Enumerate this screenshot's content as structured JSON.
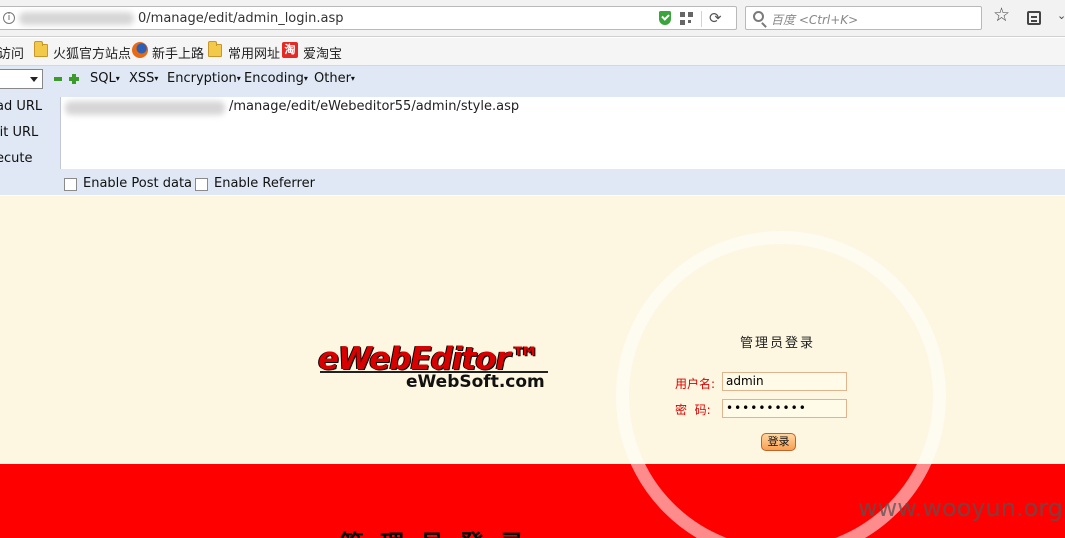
{
  "browser": {
    "url_visible": "0/manage/edit/admin_login.asp",
    "search_placeholder": "百度 <Ctrl+K>"
  },
  "bookmarks": {
    "partial_item": "访问",
    "items": [
      "火狐官方站点",
      "新手上路",
      "常用网址",
      "爱淘宝"
    ]
  },
  "hackbar": {
    "menus": [
      "SQL",
      "XSS",
      "Encryption",
      "Encoding",
      "Other"
    ],
    "actions": [
      "ad URL",
      "lit URL",
      "ecute"
    ],
    "url_field_value": "/manage/edit/eWebeditor55/admin/style.asp",
    "options": [
      "Enable Post data",
      "Enable Referrer"
    ]
  },
  "page": {
    "logo_main": "eWebEditor™",
    "logo_sub": "eWebSoft.com",
    "login_title": "管理员登录",
    "username_label": "用户名:",
    "password_label": "密  码:",
    "username_value": "admin",
    "password_value": "••••••••••",
    "login_button": "登录",
    "bottom_title": "管理员登录",
    "watermark": "www.wooyun.org"
  },
  "colors": {
    "page_bg": "#fdf6e0",
    "band": "#ff0000",
    "label_red": "#dd0000"
  }
}
